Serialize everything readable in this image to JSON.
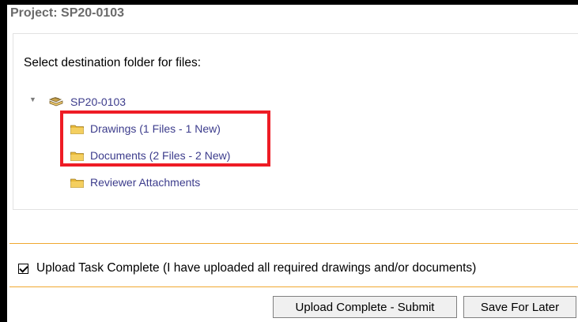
{
  "header": {
    "title": "Project: SP20-0103"
  },
  "panel": {
    "prompt": "Select destination folder for files:",
    "tree": {
      "root": {
        "label": "SP20-0103",
        "icon": "project-folder-icon",
        "expanded": true
      },
      "children": [
        {
          "label": "Drawings (1 Files - 1 New)",
          "icon": "folder-icon"
        },
        {
          "label": "Documents (2 Files - 2 New)",
          "icon": "folder-icon"
        },
        {
          "label": "Reviewer Attachments",
          "icon": "folder-icon"
        }
      ]
    }
  },
  "completion": {
    "checked": true,
    "label": "Upload Task Complete (I have uploaded all required drawings and/or documents)"
  },
  "buttons": {
    "submit": "Upload Complete - Submit",
    "later": "Save For Later"
  },
  "colors": {
    "highlight": "#ee1c25",
    "link": "#3c3c8c",
    "divider": "#f0a830",
    "folder": "#e8b93a"
  }
}
